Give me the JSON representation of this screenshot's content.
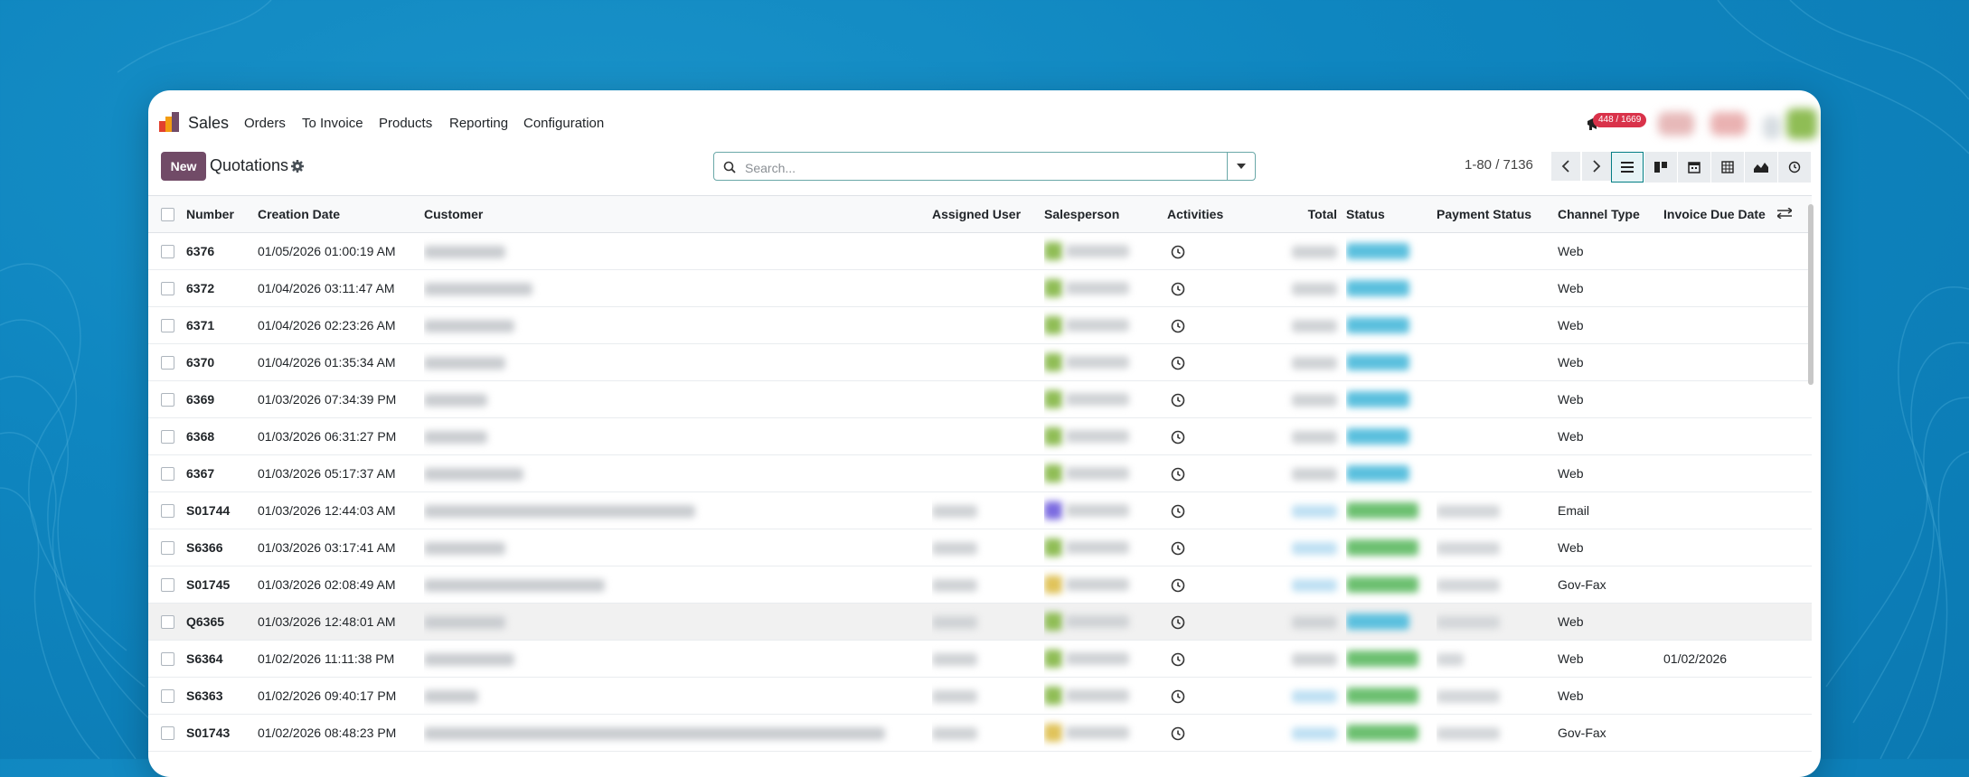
{
  "colors": {
    "brand": "#714b67",
    "accent": "#017e84",
    "badge": "#d9324a"
  },
  "nav": {
    "app_name": "Sales",
    "items": [
      "Orders",
      "To Invoice",
      "Products",
      "Reporting",
      "Configuration"
    ],
    "notification_count": "448 / 1669"
  },
  "control": {
    "new_label": "New",
    "title": "Quotations",
    "search_placeholder": "Search...",
    "pager": "1-80 / 7136",
    "views": [
      "list-view-icon",
      "kanban-view-icon",
      "calendar-view-icon",
      "pivot-view-icon",
      "graph-view-icon",
      "activity-view-icon"
    ]
  },
  "table": {
    "columns": [
      "Number",
      "Creation Date",
      "Customer",
      "Assigned User",
      "Salesperson",
      "Activities",
      "Total",
      "Status",
      "Payment Status",
      "Channel Type",
      "Invoice Due Date"
    ],
    "rows": [
      {
        "number": "6376",
        "date": "01/05/2026 01:00:19 AM",
        "channel": "Web",
        "due": "",
        "state": "quotation",
        "sp": "green",
        "user": false
      },
      {
        "number": "6372",
        "date": "01/04/2026 03:11:47 AM",
        "channel": "Web",
        "due": "",
        "state": "quotation",
        "sp": "green",
        "user": false
      },
      {
        "number": "6371",
        "date": "01/04/2026 02:23:26 AM",
        "channel": "Web",
        "due": "",
        "state": "quotation",
        "sp": "green",
        "user": false
      },
      {
        "number": "6370",
        "date": "01/04/2026 01:35:34 AM",
        "channel": "Web",
        "due": "",
        "state": "quotation",
        "sp": "green",
        "user": false
      },
      {
        "number": "6369",
        "date": "01/03/2026 07:34:39 PM",
        "channel": "Web",
        "due": "",
        "state": "quotation",
        "sp": "green",
        "user": false
      },
      {
        "number": "6368",
        "date": "01/03/2026 06:31:27 PM",
        "channel": "Web",
        "due": "",
        "state": "quotation",
        "sp": "green",
        "user": false
      },
      {
        "number": "6367",
        "date": "01/03/2026 05:17:37 AM",
        "channel": "Web",
        "due": "",
        "state": "quotation",
        "sp": "green",
        "user": false
      },
      {
        "number": "S01744",
        "date": "01/03/2026 12:44:03 AM",
        "channel": "Email",
        "due": "",
        "state": "order",
        "sp": "purple",
        "user": true
      },
      {
        "number": "S6366",
        "date": "01/03/2026 03:17:41 AM",
        "channel": "Web",
        "due": "",
        "state": "order",
        "sp": "green",
        "user": true
      },
      {
        "number": "S01745",
        "date": "01/03/2026 02:08:49 AM",
        "channel": "Gov-Fax",
        "due": "",
        "state": "order",
        "sp": "yellow",
        "user": true
      },
      {
        "number": "Q6365",
        "date": "01/03/2026 12:48:01 AM",
        "channel": "Web",
        "due": "",
        "state": "quotation",
        "sp": "green",
        "user": true
      },
      {
        "number": "S6364",
        "date": "01/02/2026 11:11:38 PM",
        "channel": "Web",
        "due": "01/02/2026",
        "state": "order",
        "sp": "green",
        "user": true
      },
      {
        "number": "S6363",
        "date": "01/02/2026 09:40:17 PM",
        "channel": "Web",
        "due": "",
        "state": "order",
        "sp": "green",
        "user": true
      },
      {
        "number": "S01743",
        "date": "01/02/2026 08:48:23 PM",
        "channel": "Gov-Fax",
        "due": "",
        "state": "order",
        "sp": "yellow",
        "user": true
      }
    ]
  }
}
